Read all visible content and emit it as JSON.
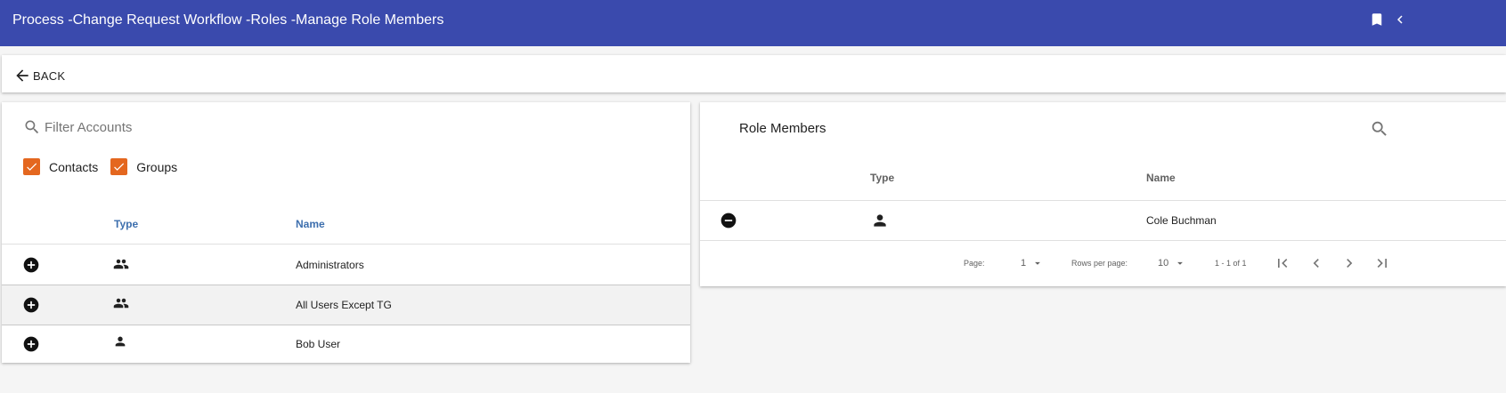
{
  "header": {
    "title": "Process -Change Request Workflow -Roles -Manage Role Members",
    "icons": [
      "bookmark-icon",
      "collapse-icon"
    ]
  },
  "backbar": {
    "back_label": "BACK",
    "icon": "arrow-left-icon"
  },
  "accounts": {
    "filter_placeholder": "Filter Accounts",
    "checkboxes": [
      {
        "label": "Contacts",
        "checked": true
      },
      {
        "label": "Groups",
        "checked": true
      }
    ],
    "columns": {
      "type": "Type",
      "name": "Name"
    },
    "rows": [
      {
        "type": "group",
        "name": "Administrators"
      },
      {
        "type": "group",
        "name": "All Users Except TG"
      },
      {
        "type": "person",
        "name": "Bob User"
      }
    ]
  },
  "role_members": {
    "title": "Role Members",
    "columns": {
      "type": "Type",
      "name": "Name"
    },
    "rows": [
      {
        "type": "person",
        "name": "Cole Buchman"
      }
    ],
    "pagination": {
      "page_label": "Page:",
      "page_value": "1",
      "rows_label": "Rows per page:",
      "rows_value": "10",
      "range": "1 - 1 of 1"
    }
  },
  "colors": {
    "appbar": "#3a4aad",
    "checkbox": "#e4671f",
    "link_header": "#3d6fae"
  }
}
